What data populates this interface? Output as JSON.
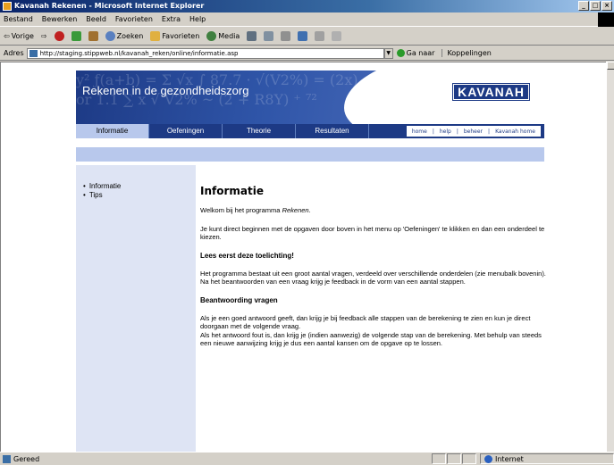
{
  "window": {
    "title": "Kavanah Rekenen - Microsoft Internet Explorer"
  },
  "menubar": [
    "Bestand",
    "Bewerken",
    "Beeld",
    "Favorieten",
    "Extra",
    "Help"
  ],
  "toolbar": {
    "back": "Vorige",
    "search": "Zoeken",
    "favorites": "Favorieten",
    "media": "Media"
  },
  "address": {
    "label": "Adres",
    "url": "http://staging.stippweb.nl/kavanah_reken/online/informatie.asp",
    "go": "Ga naar",
    "links": "Koppelingen"
  },
  "banner": {
    "title": "Rekenen in de gezondheidszorg",
    "logo": "KAVANAH"
  },
  "nav": {
    "tabs": [
      "Informatie",
      "Oefeningen",
      "Theorie",
      "Resultaten"
    ],
    "util": [
      "home",
      "help",
      "beheer",
      "Kavanah home"
    ]
  },
  "sidebar": {
    "items": [
      "Informatie",
      "Tips"
    ]
  },
  "content": {
    "title": "Informatie",
    "welcome_prefix": "Welkom bij het programma ",
    "welcome_em": "Rekenen",
    "welcome_suffix": ".",
    "intro": "Je kunt direct beginnen met de opgaven door boven in het menu op 'Oefeningen' te klikken en dan een onderdeel te kiezen.",
    "h_toelichting": "Lees eerst deze toelichting!",
    "p_toelichting": "Het programma bestaat uit een groot aantal vragen, verdeeld over verschillende onderdelen (zie menubalk bovenin). Na het beantwoorden van een vraag krijg je feedback in de vorm van een aantal stappen.",
    "h_beantwoording": "Beantwoording vragen",
    "p_beantwoording1": "Als je een goed antwoord geeft, dan krijg je bij feedback alle stappen van de berekening te zien en kun je direct doorgaan met de volgende vraag.",
    "p_beantwoording2": "Als het antwoord fout is, dan krijg je (indien aanwezig) de volgende stap van de berekening. Met behulp van steeds een nieuwe aanwijzing krijg je dus een aantal kansen om de opgave op te lossen."
  },
  "status": {
    "left": "Gereed",
    "zone": "Internet"
  }
}
